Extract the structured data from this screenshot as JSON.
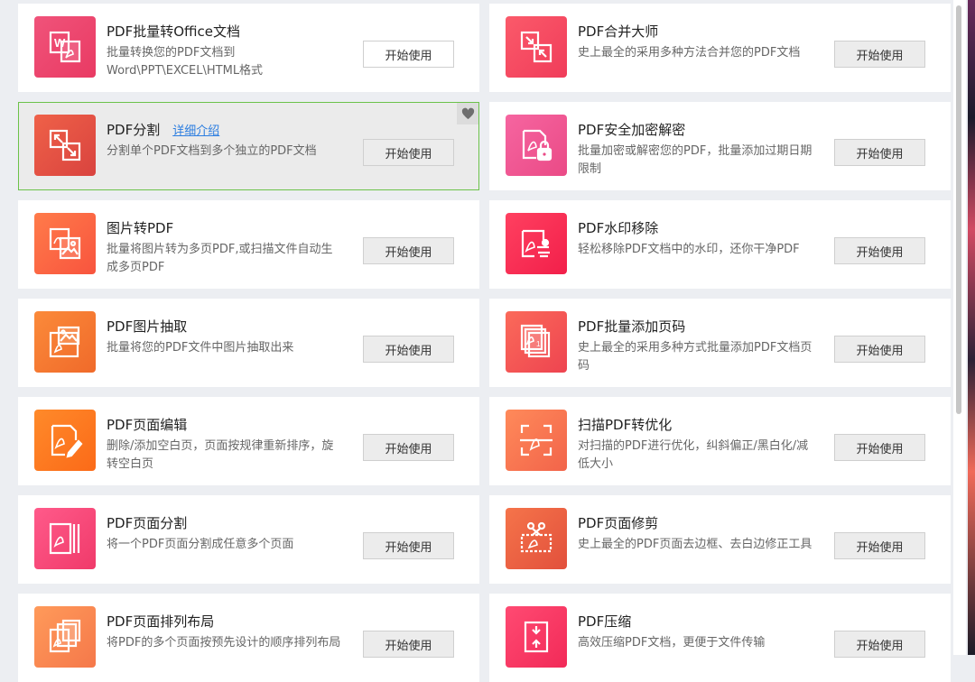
{
  "tools": [
    {
      "title": "PDF批量转Office文档",
      "desc": "批量转换您的PDF文档到Word\\PPT\\EXCEL\\HTML格式",
      "button": "开始使用",
      "icon": "word-to-pdf-icon",
      "button_style": "white",
      "color1": "#f0537a",
      "color2": "#e93a63"
    },
    {
      "title": "PDF合并大师",
      "desc": "史上最全的采用多种方法合并您的PDF文档",
      "button": "开始使用",
      "icon": "merge-arrows-icon",
      "color1": "#fb5a6a",
      "color2": "#f03c5a"
    },
    {
      "title": "PDF分割",
      "link": "详细介绍",
      "desc": "分割单个PDF文档到多个独立的PDF文档",
      "button": "开始使用",
      "icon": "split-arrows-icon",
      "active": true,
      "color1": "#ef6148",
      "color2": "#d9433f"
    },
    {
      "title": "PDF安全加密解密",
      "desc": "批量加密或解密您的PDF，批量添加过期日期限制",
      "button": "开始使用",
      "icon": "pdf-lock-icon",
      "color1": "#f665a0",
      "color2": "#ea4a86"
    },
    {
      "title": "图片转PDF",
      "desc": "批量将图片转为多页PDF,或扫描文件自动生成多页PDF",
      "button": "开始使用",
      "icon": "image-to-pdf-icon",
      "color1": "#ff7b4a",
      "color2": "#f8543e"
    },
    {
      "title": "PDF水印移除",
      "desc": "轻松移除PDF文档中的水印，还你干净PDF",
      "button": "开始使用",
      "icon": "watermark-remove-icon",
      "color1": "#ff4060",
      "color2": "#f21f4a"
    },
    {
      "title": "PDF图片抽取",
      "desc": "批量将您的PDF文件中图片抽取出来",
      "button": "开始使用",
      "icon": "image-extract-icon",
      "color1": "#fb8a3a",
      "color2": "#f06a2a"
    },
    {
      "title": "PDF批量添加页码",
      "desc": "史上最全的采用多种方式批量添加PDF文档页码",
      "button": "开始使用",
      "icon": "page-number-icon",
      "color1": "#fb6a5a",
      "color2": "#ee4450"
    },
    {
      "title": "PDF页面编辑",
      "desc": "删除/添加空白页，页面按规律重新排序，旋转空白页",
      "button": "开始使用",
      "icon": "page-edit-icon",
      "color1": "#ff8a2a",
      "color2": "#fb6a18"
    },
    {
      "title": "扫描PDF转优化",
      "desc": "对扫描的PDF进行优化，纠斜偏正/黑白化/减低大小",
      "button": "开始使用",
      "icon": "scan-optimize-icon",
      "color1": "#ff8a5a",
      "color2": "#f2644a"
    },
    {
      "title": "PDF页面分割",
      "desc": "将一个PDF页面分割成任意多个页面",
      "button": "开始使用",
      "icon": "page-split-icon",
      "color1": "#ff5a8a",
      "color2": "#f03a6a"
    },
    {
      "title": "PDF页面修剪",
      "desc": "史上最全的PDF页面去边框、去白边修正工具",
      "button": "开始使用",
      "icon": "page-crop-icon",
      "color1": "#f5744a",
      "color2": "#e2503c"
    },
    {
      "title": "PDF页面排列布局",
      "desc": "将PDF的多个页面按预先设计的顺序排列布局",
      "button": "开始使用",
      "icon": "page-layout-icon",
      "color1": "#ff9a5a",
      "color2": "#f5784a"
    },
    {
      "title": "PDF压缩",
      "desc": "高效压缩PDF文档，更便于文件传输",
      "button": "开始使用",
      "icon": "compress-icon",
      "color1": "#ff4a72",
      "color2": "#f22a58"
    }
  ]
}
